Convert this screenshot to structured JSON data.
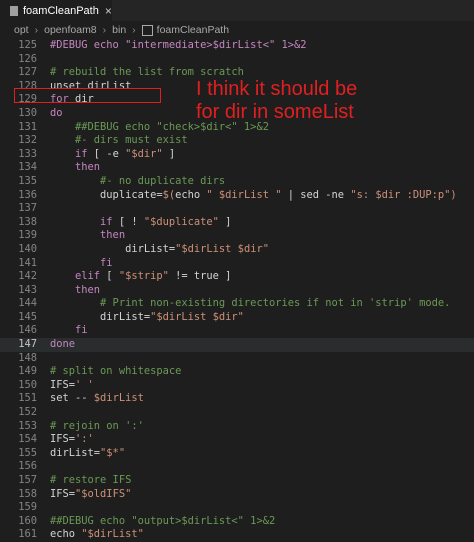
{
  "tab": {
    "label": "foamCleanPath",
    "close": "×"
  },
  "breadcrumb": [
    "opt",
    "openfoam8",
    "bin",
    "foamCleanPath"
  ],
  "annotation": {
    "line1": "I think it should be",
    "line2": "for dir in someList"
  },
  "lines": [
    {
      "n": "125",
      "tokens": [
        [
          "kw",
          "#DEBUG echo \"intermediate>$dirList<\" 1>&2"
        ]
      ]
    },
    {
      "n": "126",
      "tokens": []
    },
    {
      "n": "127",
      "tokens": [
        [
          "cmt",
          "# rebuild the list from scratch"
        ]
      ]
    },
    {
      "n": "128",
      "tokens": [
        [
          "op",
          "unset dirList"
        ]
      ]
    },
    {
      "n": "129",
      "tokens": [
        [
          "kw",
          "for"
        ],
        [
          "op",
          " dir"
        ]
      ]
    },
    {
      "n": "130",
      "tokens": [
        [
          "kw",
          "do"
        ]
      ]
    },
    {
      "n": "131",
      "tokens": [
        [
          "cmt",
          "    ##DEBUG echo \"check>$dir<\" 1>&2"
        ]
      ]
    },
    {
      "n": "132",
      "tokens": [
        [
          "cmt",
          "    #- dirs must exist"
        ]
      ]
    },
    {
      "n": "133",
      "tokens": [
        [
          "kw",
          "    if"
        ],
        [
          "op",
          " [ -e "
        ],
        [
          "str",
          "\"$dir\""
        ],
        [
          "op",
          " ]"
        ]
      ]
    },
    {
      "n": "134",
      "tokens": [
        [
          "kw",
          "    then"
        ]
      ]
    },
    {
      "n": "135",
      "tokens": [
        [
          "cmt",
          "        #- no duplicate dirs"
        ]
      ]
    },
    {
      "n": "136",
      "tokens": [
        [
          "op",
          "        duplicate="
        ],
        [
          "str",
          "$("
        ],
        [
          "op",
          "echo "
        ],
        [
          "str",
          "\" $dirList \""
        ],
        [
          "op",
          " | sed -ne "
        ],
        [
          "str",
          "\"s: $dir :DUP:p\""
        ],
        [
          "str",
          ")"
        ]
      ]
    },
    {
      "n": "137",
      "tokens": []
    },
    {
      "n": "138",
      "tokens": [
        [
          "kw",
          "        if"
        ],
        [
          "op",
          " [ ! "
        ],
        [
          "str",
          "\"$duplicate\""
        ],
        [
          "op",
          " ]"
        ]
      ]
    },
    {
      "n": "139",
      "tokens": [
        [
          "kw",
          "        then"
        ]
      ]
    },
    {
      "n": "140",
      "tokens": [
        [
          "op",
          "            dirList="
        ],
        [
          "str",
          "\"$dirList $dir\""
        ]
      ]
    },
    {
      "n": "141",
      "tokens": [
        [
          "kw",
          "        fi"
        ]
      ]
    },
    {
      "n": "142",
      "tokens": [
        [
          "kw",
          "    elif"
        ],
        [
          "op",
          " [ "
        ],
        [
          "str",
          "\"$strip\""
        ],
        [
          "op",
          " != true ]"
        ]
      ]
    },
    {
      "n": "143",
      "tokens": [
        [
          "kw",
          "    then"
        ]
      ]
    },
    {
      "n": "144",
      "tokens": [
        [
          "cmt",
          "        # Print non-existing directories if not in 'strip' mode."
        ]
      ]
    },
    {
      "n": "145",
      "tokens": [
        [
          "op",
          "        dirList="
        ],
        [
          "str",
          "\"$dirList $dir\""
        ]
      ]
    },
    {
      "n": "146",
      "tokens": [
        [
          "kw",
          "    fi"
        ]
      ]
    },
    {
      "n": "147",
      "tokens": [
        [
          "kw",
          "done"
        ]
      ],
      "current": true
    },
    {
      "n": "148",
      "tokens": []
    },
    {
      "n": "149",
      "tokens": [
        [
          "cmt",
          "# split on whitespace"
        ]
      ]
    },
    {
      "n": "150",
      "tokens": [
        [
          "op",
          "IFS="
        ],
        [
          "str",
          "' '"
        ]
      ]
    },
    {
      "n": "151",
      "tokens": [
        [
          "op",
          "set -- "
        ],
        [
          "str",
          "$dirList"
        ]
      ]
    },
    {
      "n": "152",
      "tokens": []
    },
    {
      "n": "153",
      "tokens": [
        [
          "cmt",
          "# rejoin on ':'"
        ]
      ]
    },
    {
      "n": "154",
      "tokens": [
        [
          "op",
          "IFS="
        ],
        [
          "str",
          "':'"
        ]
      ]
    },
    {
      "n": "155",
      "tokens": [
        [
          "op",
          "dirList="
        ],
        [
          "str",
          "\"$*\""
        ]
      ]
    },
    {
      "n": "156",
      "tokens": []
    },
    {
      "n": "157",
      "tokens": [
        [
          "cmt",
          "# restore IFS"
        ]
      ]
    },
    {
      "n": "158",
      "tokens": [
        [
          "op",
          "IFS="
        ],
        [
          "str",
          "\"$oldIFS\""
        ]
      ]
    },
    {
      "n": "159",
      "tokens": []
    },
    {
      "n": "160",
      "tokens": [
        [
          "cmt",
          "##DEBUG echo \"output>$dirList<\" 1>&2"
        ]
      ]
    },
    {
      "n": "161",
      "tokens": [
        [
          "op",
          "echo "
        ],
        [
          "str",
          "\"$dirList\""
        ]
      ]
    }
  ]
}
